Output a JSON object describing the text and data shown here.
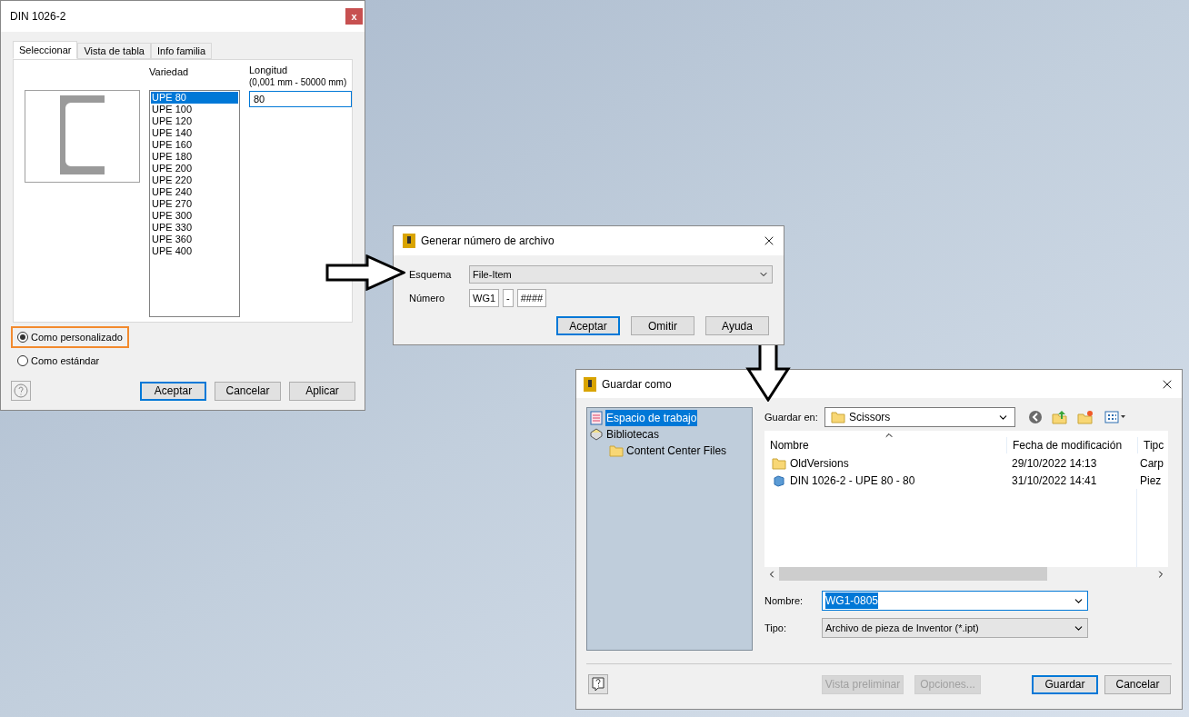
{
  "din_dialog": {
    "title": "DIN 1026-2",
    "close": "x",
    "tabs": [
      {
        "label": "Seleccionar",
        "selected": true
      },
      {
        "label": "Vista de tabla",
        "selected": false
      },
      {
        "label": "Info familia",
        "selected": false
      }
    ],
    "variety_label": "Variedad",
    "varieties": [
      {
        "label": "UPE 80",
        "selected": true
      },
      {
        "label": "UPE 100",
        "selected": false
      },
      {
        "label": "UPE 120",
        "selected": false
      },
      {
        "label": "UPE 140",
        "selected": false
      },
      {
        "label": "UPE 160",
        "selected": false
      },
      {
        "label": "UPE 180",
        "selected": false
      },
      {
        "label": "UPE 200",
        "selected": false
      },
      {
        "label": "UPE 220",
        "selected": false
      },
      {
        "label": "UPE 240",
        "selected": false
      },
      {
        "label": "UPE 270",
        "selected": false
      },
      {
        "label": "UPE 300",
        "selected": false
      },
      {
        "label": "UPE 330",
        "selected": false
      },
      {
        "label": "UPE 360",
        "selected": false
      },
      {
        "label": "UPE 400",
        "selected": false
      }
    ],
    "length_label": "Longitud",
    "length_range": "(0,001 mm - 50000 mm)",
    "length_value": "80",
    "options": [
      {
        "label": "Como personalizado",
        "selected": true,
        "highlighted": true
      },
      {
        "label": "Como estándar",
        "selected": false,
        "highlighted": false
      }
    ],
    "buttons": [
      {
        "label": "Aceptar",
        "default": true
      },
      {
        "label": "Cancelar",
        "default": false
      },
      {
        "label": "Aplicar",
        "default": false
      }
    ]
  },
  "number_dialog": {
    "title": "Generar número de archivo",
    "scheme_label": "Esquema",
    "scheme_value": "File-Item",
    "number_label": "Número",
    "number_parts": [
      "WG1",
      "-",
      "####"
    ],
    "buttons": [
      {
        "label": "Aceptar",
        "default": true
      },
      {
        "label": "Omitir",
        "default": false
      },
      {
        "label": "Ayuda",
        "default": false
      }
    ]
  },
  "save_dialog": {
    "title": "Guardar como",
    "places": [
      {
        "label": "Espacio de trabajo",
        "kind": "workspace",
        "selected": true
      },
      {
        "label": "Bibliotecas",
        "kind": "library",
        "selected": false,
        "children": [
          {
            "label": "Content Center Files",
            "kind": "folder",
            "selected": false
          }
        ]
      }
    ],
    "save_in_label": "Guardar en:",
    "save_in_value": "Scissors",
    "columns": [
      "Nombre",
      "Fecha de modificación",
      "Tipc"
    ],
    "files": [
      {
        "kind": "folder",
        "name": "OldVersions",
        "date": "29/10/2022 14:13",
        "type": "Carp"
      },
      {
        "kind": "part",
        "name": "DIN 1026-2 - UPE 80 - 80",
        "date": "31/10/2022 14:41",
        "type": "Piez"
      }
    ],
    "name_label": "Nombre:",
    "name_value": "WG1-0805",
    "type_label": "Tipo:",
    "type_value": "Archivo de pieza de Inventor (*.ipt)",
    "buttons": [
      {
        "label": "Vista preliminar",
        "disabled": true,
        "default": false
      },
      {
        "label": "Opciones...",
        "disabled": true,
        "default": false
      },
      {
        "label": "Guardar",
        "disabled": false,
        "default": true
      },
      {
        "label": "Cancelar",
        "disabled": false,
        "default": false
      }
    ]
  }
}
